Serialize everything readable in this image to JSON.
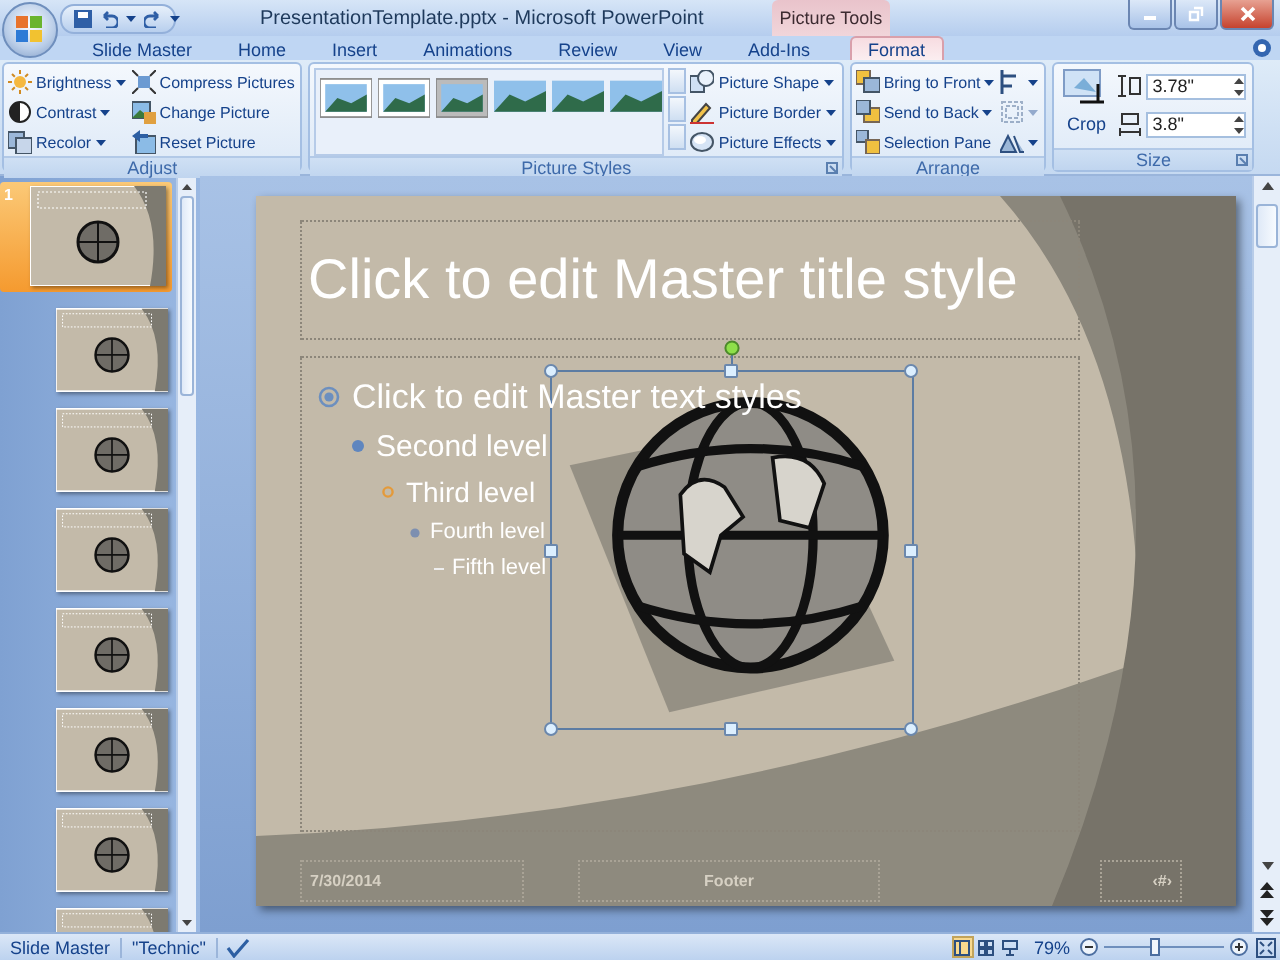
{
  "window": {
    "title": "PresentationTemplate.pptx - Microsoft PowerPoint",
    "context_tab_group": "Picture Tools"
  },
  "tabs": [
    {
      "label": "Slide Master",
      "selected": false
    },
    {
      "label": "Home",
      "selected": false
    },
    {
      "label": "Insert",
      "selected": false
    },
    {
      "label": "Animations",
      "selected": false
    },
    {
      "label": "Review",
      "selected": false
    },
    {
      "label": "View",
      "selected": false
    },
    {
      "label": "Add-Ins",
      "selected": false
    },
    {
      "label": "Format",
      "selected": true
    }
  ],
  "adjust": {
    "label": "Adjust",
    "buttons": [
      {
        "label": "Brightness",
        "dropdown": true
      },
      {
        "label": "Compress Pictures",
        "dropdown": false
      },
      {
        "label": "Contrast",
        "dropdown": true
      },
      {
        "label": "Change Picture",
        "dropdown": false
      },
      {
        "label": "Recolor",
        "dropdown": true
      },
      {
        "label": "Reset Picture",
        "dropdown": false
      }
    ]
  },
  "picture_styles": {
    "label": "Picture Styles",
    "buttons": [
      {
        "label": "Picture Shape",
        "dropdown": true
      },
      {
        "label": "Picture Border",
        "dropdown": true
      },
      {
        "label": "Picture Effects",
        "dropdown": true
      }
    ]
  },
  "arrange": {
    "label": "Arrange",
    "buttons": [
      {
        "label": "Bring to Front",
        "dropdown": true
      },
      {
        "label": "Send to Back",
        "dropdown": true
      },
      {
        "label": "Selection Pane",
        "dropdown": false
      }
    ],
    "icon_buttons": [
      {
        "disabled": false
      },
      {
        "disabled": true
      },
      {
        "disabled": false
      }
    ]
  },
  "size": {
    "label": "Size",
    "crop": "Crop",
    "height": "3.78\"",
    "width": "3.8\""
  },
  "slide_pane": {
    "thumbnails": [
      {
        "number": "1",
        "selected": true
      },
      {
        "selected": false
      },
      {
        "selected": false
      },
      {
        "selected": false
      },
      {
        "selected": false
      },
      {
        "selected": false
      },
      {
        "selected": false
      },
      {
        "selected": false
      }
    ]
  },
  "slide": {
    "title": "Click to edit Master title style",
    "body": [
      {
        "text": "Click to edit Master text styles",
        "children": [
          {
            "text": "Second level",
            "children": [
              {
                "text": "Third level",
                "children": [
                  {
                    "text": "Fourth level",
                    "children": [
                      {
                        "text": "Fifth level"
                      }
                    ]
                  }
                ]
              }
            ]
          }
        ]
      }
    ],
    "footer": {
      "date": "7/30/2014",
      "text": "Footer",
      "number": "‹#›"
    }
  },
  "status_bar": {
    "mode": "Slide Master",
    "theme": "\"Technic\"",
    "views": [
      {
        "selected": true
      },
      {
        "selected": false
      },
      {
        "selected": false
      }
    ],
    "zoom": "79%",
    "zoom_slider": {
      "level": 0.41
    }
  }
}
